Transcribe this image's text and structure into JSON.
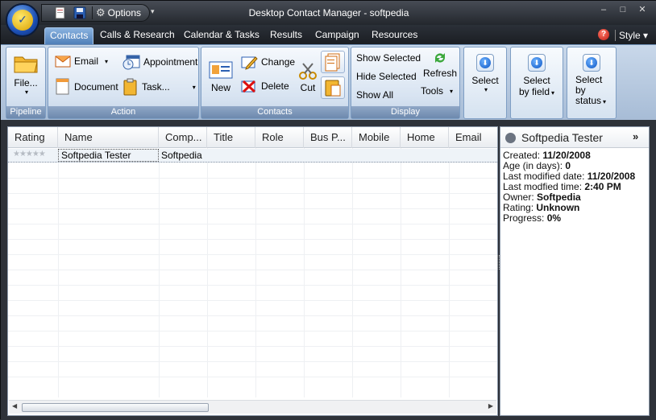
{
  "window": {
    "title": "Desktop Contact Manager - softpedia",
    "minimize": "–",
    "maximize": "□",
    "close": "✕"
  },
  "qat": {
    "options_label": "Options",
    "dropdown": "▾"
  },
  "tabs": [
    "Contacts",
    "Calls & Research",
    "Calendar & Tasks",
    "Results",
    "Campaign",
    "Resources"
  ],
  "active_tab": "Contacts",
  "help": "?",
  "style_menu": "Style ▾",
  "ribbon": {
    "pipeline": {
      "label": "Pipeline",
      "file_label": "File...",
      "file_caret": "▾"
    },
    "action": {
      "label": "Action",
      "email": "Email",
      "appointment": "Appointment",
      "document": "Document",
      "task": "Task...",
      "caret": "▾"
    },
    "contacts": {
      "label": "Contacts",
      "new": "New",
      "change": "Change",
      "delete": "Delete",
      "cut": "Cut"
    },
    "display": {
      "label": "Display",
      "show_selected": "Show Selected",
      "hide_selected": "Hide Selected",
      "show_all": "Show All",
      "refresh": "Refresh",
      "tools": "Tools",
      "caret": "▾"
    },
    "select": {
      "label": "Select",
      "caret": "▾"
    },
    "select_by_field": {
      "line1": "Select",
      "line2": "by field",
      "caret": "▾"
    },
    "select_by_status": {
      "line1": "Select",
      "line2": "by",
      "line3": "status",
      "caret": "▾"
    }
  },
  "grid": {
    "columns": [
      "Rating",
      "Name",
      "Comp...",
      "Title",
      "Role",
      "Bus P...",
      "Mobile",
      "Home",
      "Email"
    ],
    "rows": [
      {
        "rating": "★★★★★",
        "name": "Softpedia Tester",
        "company": "Softpedia"
      }
    ],
    "scroll_left": "◀",
    "scroll_right": "▶"
  },
  "details": {
    "name": "Softpedia Tester",
    "collapse": "»",
    "fields": [
      {
        "label": "Created:",
        "value": "11/20/2008"
      },
      {
        "label": "Age (in days):",
        "value": "0"
      },
      {
        "label": "Last modified date:",
        "value": "11/20/2008"
      },
      {
        "label": "Last modfied time:",
        "value": "2:40 PM"
      },
      {
        "label": "Owner:",
        "value": "Softpedia"
      },
      {
        "label": "Rating:",
        "value": "Unknown"
      },
      {
        "label": "Progress:",
        "value": "0%"
      }
    ]
  },
  "colors": {
    "accent": "#4e7fb8",
    "ribbon": "#c9d8ea",
    "chrome": "#23272d"
  }
}
